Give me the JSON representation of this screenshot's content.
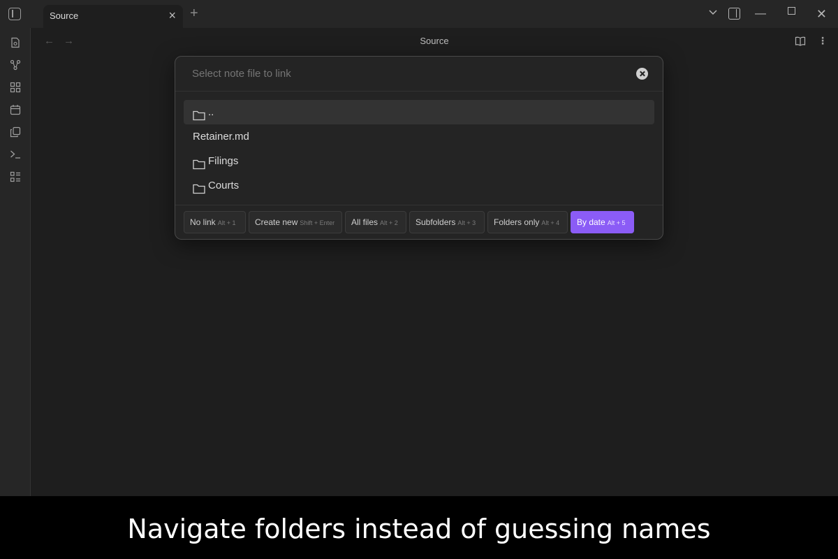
{
  "tab": {
    "label": "Source"
  },
  "header": {
    "title": "Source"
  },
  "modal": {
    "placeholder": "Select note file to link",
    "results": [
      {
        "label": "..",
        "type": "folder",
        "selected": true
      },
      {
        "label": "Retainer.md",
        "type": "file",
        "selected": false
      },
      {
        "label": "Filings",
        "type": "folder",
        "selected": false
      },
      {
        "label": "Courts",
        "type": "folder",
        "selected": false
      }
    ],
    "filters": [
      {
        "label": "No link",
        "shortcut": "Alt + 1",
        "active": false
      },
      {
        "label": "Create new",
        "shortcut": "Shift + Enter",
        "active": false
      },
      {
        "label": "All files",
        "shortcut": "Alt + 2",
        "active": false
      },
      {
        "label": "Subfolders",
        "shortcut": "Alt + 3",
        "active": false
      },
      {
        "label": "Folders only",
        "shortcut": "Alt + 4",
        "active": false
      },
      {
        "label": "By date",
        "shortcut": "Alt + 5",
        "active": true
      }
    ]
  },
  "caption": "Navigate folders instead of guessing names",
  "colors": {
    "accent": "#8b5cf6",
    "background": "#1e1e1e"
  },
  "ribbon_icons": [
    "file-icon",
    "graph-icon",
    "grid-icon",
    "calendar-icon",
    "copy-icon",
    "terminal-icon",
    "list-icon"
  ]
}
